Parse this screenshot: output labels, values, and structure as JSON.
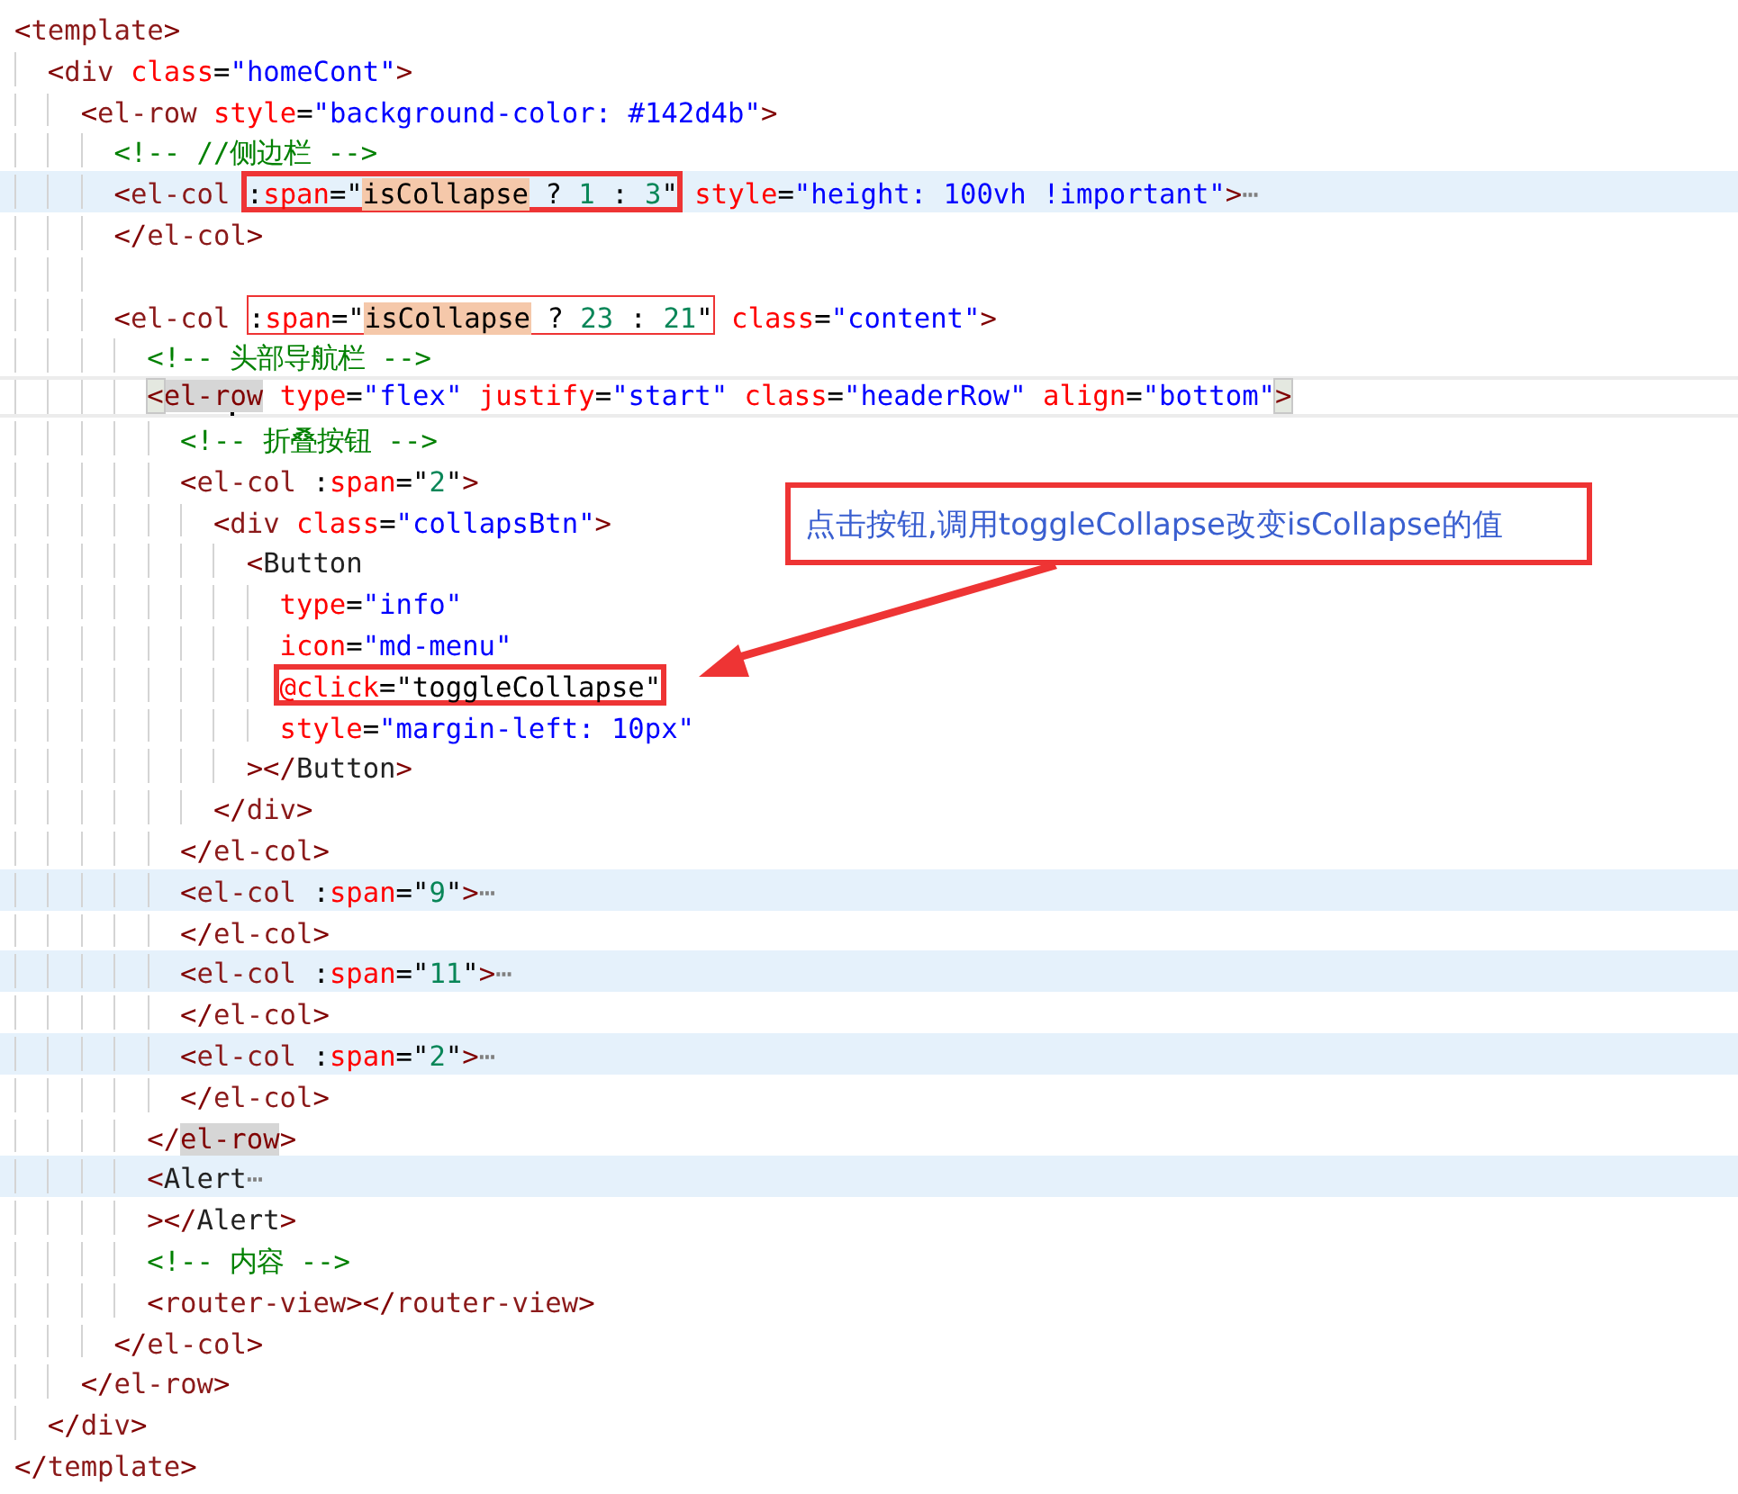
{
  "editor": {
    "lines": [
      {
        "kind": "code",
        "highlighted": false,
        "current": false,
        "tokens": [
          {
            "kind": "p",
            "text": "<"
          },
          {
            "kind": "tag",
            "text": "template"
          },
          {
            "kind": "p",
            "text": ">"
          }
        ],
        "children": [
          {
            "kind": "code",
            "highlighted": false,
            "current": false,
            "tokens": [
              {
                "kind": "p",
                "text": "<"
              },
              {
                "kind": "tag",
                "text": "div"
              },
              {
                "kind": "attr",
                "text": " class"
              },
              {
                "kind": "txt",
                "text": "="
              },
              {
                "kind": "str",
                "text": "\"homeCont\""
              },
              {
                "kind": "p",
                "text": ">"
              }
            ],
            "children": [
              {
                "kind": "code",
                "highlighted": false,
                "current": false,
                "tokens": [
                  {
                    "kind": "p",
                    "text": "<"
                  },
                  {
                    "kind": "tag",
                    "text": "el-row"
                  },
                  {
                    "kind": "attr",
                    "text": " style"
                  },
                  {
                    "kind": "txt",
                    "text": "="
                  },
                  {
                    "kind": "str",
                    "text": "\"background-color: #142d4b\""
                  },
                  {
                    "kind": "p",
                    "text": ">"
                  }
                ],
                "children": [
                  {
                    "kind": "code",
                    "highlighted": false,
                    "current": false,
                    "tokens": [
                      {
                        "kind": "cm",
                        "text": "<!-- //侧边栏 -->"
                      }
                    ]
                  },
                  {
                    "kind": "code",
                    "highlighted": true,
                    "current": false,
                    "tokens": [
                      {
                        "kind": "p",
                        "text": "<"
                      },
                      {
                        "kind": "tag",
                        "text": "el-col "
                      },
                      {
                        "kind": "box",
                        "bold": true,
                        "tokens": [
                          {
                            "kind": "txt",
                            "text": ":"
                          },
                          {
                            "kind": "attr",
                            "text": "span"
                          },
                          {
                            "kind": "txt",
                            "text": "=\""
                          },
                          {
                            "kind": "match",
                            "text": "isCollapse"
                          },
                          {
                            "kind": "txt",
                            "text": " ? "
                          },
                          {
                            "kind": "num",
                            "text": "1"
                          },
                          {
                            "kind": "txt",
                            "text": " : "
                          },
                          {
                            "kind": "num",
                            "text": "3"
                          },
                          {
                            "kind": "txt",
                            "text": "\""
                          }
                        ]
                      },
                      {
                        "kind": "attr",
                        "text": " style"
                      },
                      {
                        "kind": "txt",
                        "text": "="
                      },
                      {
                        "kind": "str",
                        "text": "\"height: 100vh !important\""
                      },
                      {
                        "kind": "p",
                        "text": ">"
                      },
                      {
                        "kind": "fold",
                        "text": "⋯"
                      }
                    ]
                  },
                  {
                    "kind": "code",
                    "highlighted": false,
                    "current": false,
                    "tokens": [
                      {
                        "kind": "p",
                        "text": "</"
                      },
                      {
                        "kind": "tag",
                        "text": "el-col"
                      },
                      {
                        "kind": "p",
                        "text": ">"
                      }
                    ]
                  },
                  {
                    "kind": "blank",
                    "highlighted": false,
                    "current": false
                  },
                  {
                    "kind": "code",
                    "highlighted": false,
                    "current": false,
                    "tokens": [
                      {
                        "kind": "p",
                        "text": "<"
                      },
                      {
                        "kind": "tag",
                        "text": "el-col "
                      },
                      {
                        "kind": "box",
                        "bold": false,
                        "tokens": [
                          {
                            "kind": "txt",
                            "text": ":"
                          },
                          {
                            "kind": "attr",
                            "text": "span"
                          },
                          {
                            "kind": "txt",
                            "text": "=\""
                          },
                          {
                            "kind": "match",
                            "text": "isCollapse"
                          },
                          {
                            "kind": "txt",
                            "text": " ? "
                          },
                          {
                            "kind": "num",
                            "text": "23"
                          },
                          {
                            "kind": "txt",
                            "text": " : "
                          },
                          {
                            "kind": "num",
                            "text": "21"
                          },
                          {
                            "kind": "txt",
                            "text": "\""
                          }
                        ]
                      },
                      {
                        "kind": "attr",
                        "text": " class"
                      },
                      {
                        "kind": "txt",
                        "text": "="
                      },
                      {
                        "kind": "str",
                        "text": "\"content\""
                      },
                      {
                        "kind": "p",
                        "text": ">"
                      }
                    ],
                    "children": [
                      {
                        "kind": "code",
                        "highlighted": false,
                        "current": false,
                        "tokens": [
                          {
                            "kind": "cm",
                            "text": "<!-- 头部导航栏 -->"
                          }
                        ]
                      },
                      {
                        "kind": "code",
                        "highlighted": false,
                        "current": true,
                        "tokens": [
                          {
                            "kind": "bracket",
                            "text": "<"
                          },
                          {
                            "kind": "pair",
                            "text": "el-r"
                          },
                          {
                            "kind": "caret"
                          },
                          {
                            "kind": "pair",
                            "text": "ow"
                          },
                          {
                            "kind": "attr",
                            "text": " type"
                          },
                          {
                            "kind": "txt",
                            "text": "="
                          },
                          {
                            "kind": "str",
                            "text": "\"flex\""
                          },
                          {
                            "kind": "attr",
                            "text": " justify"
                          },
                          {
                            "kind": "txt",
                            "text": "="
                          },
                          {
                            "kind": "str",
                            "text": "\"start\""
                          },
                          {
                            "kind": "attr",
                            "text": " class"
                          },
                          {
                            "kind": "txt",
                            "text": "="
                          },
                          {
                            "kind": "str",
                            "text": "\"headerRow\""
                          },
                          {
                            "kind": "attr",
                            "text": " align"
                          },
                          {
                            "kind": "txt",
                            "text": "="
                          },
                          {
                            "kind": "str",
                            "text": "\"bottom\""
                          },
                          {
                            "kind": "bracket",
                            "text": ">"
                          }
                        ],
                        "children": [
                          {
                            "kind": "code",
                            "highlighted": false,
                            "current": false,
                            "tokens": [
                              {
                                "kind": "cm",
                                "text": "<!-- 折叠按钮 -->"
                              }
                            ]
                          },
                          {
                            "kind": "code",
                            "highlighted": false,
                            "current": false,
                            "tokens": [
                              {
                                "kind": "p",
                                "text": "<"
                              },
                              {
                                "kind": "tag",
                                "text": "el-col"
                              },
                              {
                                "kind": "txt",
                                "text": " :"
                              },
                              {
                                "kind": "attr",
                                "text": "span"
                              },
                              {
                                "kind": "txt",
                                "text": "=\""
                              },
                              {
                                "kind": "num",
                                "text": "2"
                              },
                              {
                                "kind": "txt",
                                "text": "\""
                              },
                              {
                                "kind": "p",
                                "text": ">"
                              }
                            ],
                            "children": [
                              {
                                "kind": "code",
                                "highlighted": false,
                                "current": false,
                                "tokens": [
                                  {
                                    "kind": "p",
                                    "text": "<"
                                  },
                                  {
                                    "kind": "tag",
                                    "text": "div"
                                  },
                                  {
                                    "kind": "attr",
                                    "text": " class"
                                  },
                                  {
                                    "kind": "txt",
                                    "text": "="
                                  },
                                  {
                                    "kind": "str",
                                    "text": "\"collapsBtn\""
                                  },
                                  {
                                    "kind": "p",
                                    "text": ">"
                                  }
                                ],
                                "children": [
                                  {
                                    "kind": "code",
                                    "highlighted": false,
                                    "current": false,
                                    "tokens": [
                                      {
                                        "kind": "p",
                                        "text": "<"
                                      },
                                      {
                                        "kind": "comp",
                                        "text": "Button"
                                      }
                                    ],
                                    "children": [
                                      {
                                        "kind": "code",
                                        "highlighted": false,
                                        "current": false,
                                        "tokens": [
                                          {
                                            "kind": "attr",
                                            "text": "type"
                                          },
                                          {
                                            "kind": "txt",
                                            "text": "="
                                          },
                                          {
                                            "kind": "str",
                                            "text": "\"info\""
                                          }
                                        ]
                                      },
                                      {
                                        "kind": "code",
                                        "highlighted": false,
                                        "current": false,
                                        "tokens": [
                                          {
                                            "kind": "attr",
                                            "text": "icon"
                                          },
                                          {
                                            "kind": "txt",
                                            "text": "="
                                          },
                                          {
                                            "kind": "str",
                                            "text": "\"md-menu\""
                                          }
                                        ]
                                      },
                                      {
                                        "kind": "code",
                                        "highlighted": false,
                                        "current": false,
                                        "tokens": [
                                          {
                                            "kind": "box",
                                            "bold": true,
                                            "tokens": [
                                              {
                                                "kind": "attr",
                                                "text": "@click"
                                              },
                                              {
                                                "kind": "txt",
                                                "text": "=\"toggleCollapse\""
                                              }
                                            ]
                                          }
                                        ]
                                      },
                                      {
                                        "kind": "code",
                                        "highlighted": false,
                                        "current": false,
                                        "tokens": [
                                          {
                                            "kind": "attr",
                                            "text": "style"
                                          },
                                          {
                                            "kind": "txt",
                                            "text": "="
                                          },
                                          {
                                            "kind": "str",
                                            "text": "\"margin-left: 10px\""
                                          }
                                        ]
                                      }
                                    ]
                                  },
                                  {
                                    "kind": "code",
                                    "highlighted": false,
                                    "current": false,
                                    "tokens": [
                                      {
                                        "kind": "p",
                                        "text": "></"
                                      },
                                      {
                                        "kind": "comp",
                                        "text": "Button"
                                      },
                                      {
                                        "kind": "p",
                                        "text": ">"
                                      }
                                    ]
                                  }
                                ]
                              },
                              {
                                "kind": "code",
                                "highlighted": false,
                                "current": false,
                                "tokens": [
                                  {
                                    "kind": "p",
                                    "text": "</"
                                  },
                                  {
                                    "kind": "tag",
                                    "text": "div"
                                  },
                                  {
                                    "kind": "p",
                                    "text": ">"
                                  }
                                ]
                              }
                            ]
                          },
                          {
                            "kind": "code",
                            "highlighted": false,
                            "current": false,
                            "tokens": [
                              {
                                "kind": "p",
                                "text": "</"
                              },
                              {
                                "kind": "tag",
                                "text": "el-col"
                              },
                              {
                                "kind": "p",
                                "text": ">"
                              }
                            ]
                          },
                          {
                            "kind": "code",
                            "highlighted": true,
                            "current": false,
                            "tokens": [
                              {
                                "kind": "p",
                                "text": "<"
                              },
                              {
                                "kind": "tag",
                                "text": "el-col"
                              },
                              {
                                "kind": "txt",
                                "text": " :"
                              },
                              {
                                "kind": "attr",
                                "text": "span"
                              },
                              {
                                "kind": "txt",
                                "text": "=\""
                              },
                              {
                                "kind": "num",
                                "text": "9"
                              },
                              {
                                "kind": "txt",
                                "text": "\""
                              },
                              {
                                "kind": "p",
                                "text": ">"
                              },
                              {
                                "kind": "fold",
                                "text": "⋯"
                              }
                            ]
                          },
                          {
                            "kind": "code",
                            "highlighted": false,
                            "current": false,
                            "tokens": [
                              {
                                "kind": "p",
                                "text": "</"
                              },
                              {
                                "kind": "tag",
                                "text": "el-col"
                              },
                              {
                                "kind": "p",
                                "text": ">"
                              }
                            ]
                          },
                          {
                            "kind": "code",
                            "highlighted": true,
                            "current": false,
                            "tokens": [
                              {
                                "kind": "p",
                                "text": "<"
                              },
                              {
                                "kind": "tag",
                                "text": "el-col"
                              },
                              {
                                "kind": "txt",
                                "text": " :"
                              },
                              {
                                "kind": "attr",
                                "text": "span"
                              },
                              {
                                "kind": "txt",
                                "text": "=\""
                              },
                              {
                                "kind": "num",
                                "text": "11"
                              },
                              {
                                "kind": "txt",
                                "text": "\""
                              },
                              {
                                "kind": "p",
                                "text": ">"
                              },
                              {
                                "kind": "fold",
                                "text": "⋯"
                              }
                            ]
                          },
                          {
                            "kind": "code",
                            "highlighted": false,
                            "current": false,
                            "tokens": [
                              {
                                "kind": "p",
                                "text": "</"
                              },
                              {
                                "kind": "tag",
                                "text": "el-col"
                              },
                              {
                                "kind": "p",
                                "text": ">"
                              }
                            ]
                          },
                          {
                            "kind": "code",
                            "highlighted": true,
                            "current": false,
                            "tokens": [
                              {
                                "kind": "p",
                                "text": "<"
                              },
                              {
                                "kind": "tag",
                                "text": "el-col"
                              },
                              {
                                "kind": "txt",
                                "text": " :"
                              },
                              {
                                "kind": "attr",
                                "text": "span"
                              },
                              {
                                "kind": "txt",
                                "text": "=\""
                              },
                              {
                                "kind": "num",
                                "text": "2"
                              },
                              {
                                "kind": "txt",
                                "text": "\""
                              },
                              {
                                "kind": "p",
                                "text": ">"
                              },
                              {
                                "kind": "fold",
                                "text": "⋯"
                              }
                            ]
                          },
                          {
                            "kind": "code",
                            "highlighted": false,
                            "current": false,
                            "tokens": [
                              {
                                "kind": "p",
                                "text": "</"
                              },
                              {
                                "kind": "tag",
                                "text": "el-col"
                              },
                              {
                                "kind": "p",
                                "text": ">"
                              }
                            ]
                          }
                        ]
                      },
                      {
                        "kind": "code",
                        "highlighted": false,
                        "current": false,
                        "tokens": [
                          {
                            "kind": "p",
                            "text": "</"
                          },
                          {
                            "kind": "pair",
                            "text": "el-row"
                          },
                          {
                            "kind": "p",
                            "text": ">"
                          }
                        ]
                      },
                      {
                        "kind": "code",
                        "highlighted": true,
                        "current": false,
                        "tokens": [
                          {
                            "kind": "p",
                            "text": "<"
                          },
                          {
                            "kind": "comp",
                            "text": "Alert"
                          },
                          {
                            "kind": "fold",
                            "text": "⋯"
                          }
                        ]
                      },
                      {
                        "kind": "code",
                        "highlighted": false,
                        "current": false,
                        "tokens": [
                          {
                            "kind": "p",
                            "text": "></"
                          },
                          {
                            "kind": "comp",
                            "text": "Alert"
                          },
                          {
                            "kind": "p",
                            "text": ">"
                          }
                        ]
                      },
                      {
                        "kind": "code",
                        "highlighted": false,
                        "current": false,
                        "tokens": [
                          {
                            "kind": "cm",
                            "text": "<!-- 内容 -->"
                          }
                        ]
                      },
                      {
                        "kind": "code",
                        "highlighted": false,
                        "current": false,
                        "tokens": [
                          {
                            "kind": "p",
                            "text": "<"
                          },
                          {
                            "kind": "tag",
                            "text": "router-view"
                          },
                          {
                            "kind": "p",
                            "text": "></"
                          },
                          {
                            "kind": "tag",
                            "text": "router-view"
                          },
                          {
                            "kind": "p",
                            "text": ">"
                          }
                        ]
                      }
                    ]
                  },
                  {
                    "kind": "code",
                    "highlighted": false,
                    "current": false,
                    "tokens": [
                      {
                        "kind": "p",
                        "text": "</"
                      },
                      {
                        "kind": "tag",
                        "text": "el-col"
                      },
                      {
                        "kind": "p",
                        "text": ">"
                      }
                    ]
                  }
                ]
              },
              {
                "kind": "code",
                "highlighted": false,
                "current": false,
                "tokens": [
                  {
                    "kind": "p",
                    "text": "</"
                  },
                  {
                    "kind": "tag",
                    "text": "el-row"
                  },
                  {
                    "kind": "p",
                    "text": ">"
                  }
                ]
              }
            ]
          },
          {
            "kind": "code",
            "highlighted": false,
            "current": false,
            "tokens": [
              {
                "kind": "p",
                "text": "</"
              },
              {
                "kind": "tag",
                "text": "div"
              },
              {
                "kind": "p",
                "text": ">"
              }
            ]
          }
        ]
      },
      {
        "kind": "code",
        "highlighted": false,
        "current": false,
        "tokens": [
          {
            "kind": "p",
            "text": "</"
          },
          {
            "kind": "tag",
            "text": "template"
          },
          {
            "kind": "p",
            "text": ">"
          }
        ]
      }
    ]
  },
  "callout": {
    "text": "点击按钮,调用toggleCollapse改变isCollapse的值"
  }
}
